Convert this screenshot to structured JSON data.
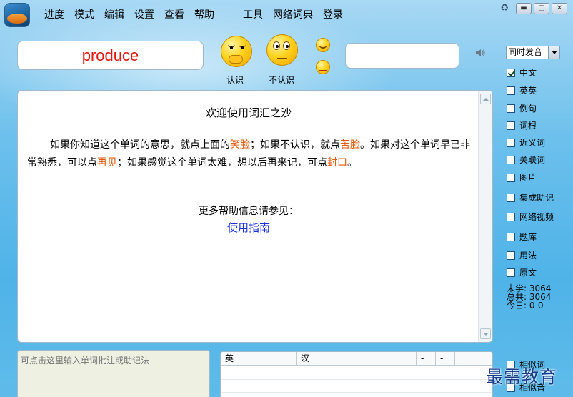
{
  "menu": {
    "items": [
      "进度",
      "模式",
      "编辑",
      "设置",
      "查看",
      "帮助"
    ],
    "tools": [
      "工具",
      "网络词典",
      "登录"
    ]
  },
  "window": {
    "min": "▬",
    "max": "▢",
    "close": "✕"
  },
  "current_word": "produce",
  "faces": {
    "know_label": "认识",
    "unknown_label": "不认识"
  },
  "search": {
    "value": "",
    "placeholder": ""
  },
  "pronounce_mode": {
    "selected": "同时发音"
  },
  "welcome": {
    "title": "欢迎使用词汇之沙",
    "p1_a": "如果你知道这个单词的意思，就点上面的",
    "p1_hl1": "笑脸",
    "p1_b": "；如果不认识，就点",
    "p1_hl2": "苦脸",
    "p1_c": "。如果对这个单词早已非常熟悉，可以点",
    "p1_hl3": "再见",
    "p1_d": "；如果感觉这个单词太难，想以后再来记，可点",
    "p1_hl4": "封口",
    "p1_e": "。",
    "more": "更多帮助信息请参见：",
    "guide_link": "使用指南"
  },
  "options": [
    {
      "label": "中文",
      "checked": true
    },
    {
      "label": "英英",
      "checked": false
    },
    {
      "label": "例句",
      "checked": false
    },
    {
      "label": "词根",
      "checked": false
    },
    {
      "label": "近义词",
      "checked": false
    },
    {
      "label": "关联词",
      "checked": false
    },
    {
      "label": "图片",
      "checked": false
    },
    {
      "label": "集成助记",
      "checked": false
    },
    {
      "label": "网络视频",
      "checked": false
    },
    {
      "label": "题库",
      "checked": false
    },
    {
      "label": "用法",
      "checked": false
    },
    {
      "label": "原文",
      "checked": false
    }
  ],
  "stats": {
    "unlearned": "未学: 3064",
    "total": "总共: 3064",
    "today": "今日: 0-0"
  },
  "note": {
    "placeholder": "可点击这里输入单词批注或助记法"
  },
  "table": {
    "headers": [
      "英",
      "汉",
      "-",
      "-"
    ]
  },
  "bottom_options": [
    {
      "label": "相似词",
      "checked": false
    },
    {
      "label": "相似音",
      "checked": false
    }
  ],
  "watermark": "最需教育",
  "colors": {
    "word": "#e3150d",
    "highlight": "#e25a0b",
    "link": "#1a2ed8"
  }
}
